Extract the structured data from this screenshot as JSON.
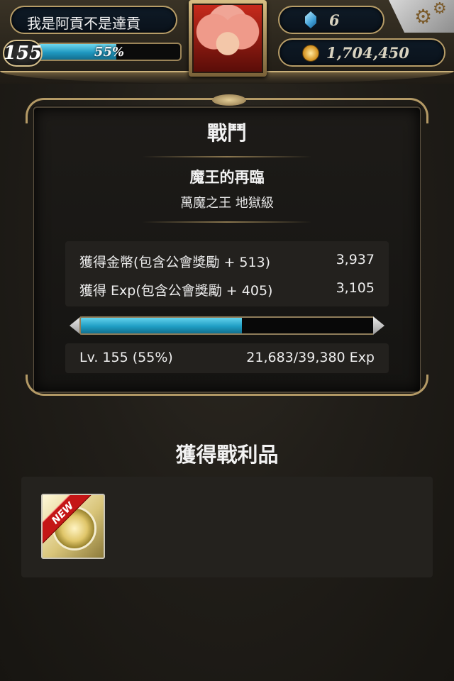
{
  "player": {
    "name": "我是阿貢不是達貢",
    "level": "155",
    "exp_percent_label": "55%",
    "exp_fraction": 0.55
  },
  "currency": {
    "gems": "6",
    "coins": "1,704,450"
  },
  "battle": {
    "title": "戰鬥",
    "stage_name": "魔王的再臨",
    "stage_sub": "萬魔之王 地獄級",
    "rewards": [
      {
        "label": "獲得金幣(包含公會獎勵 + 513)",
        "value": "3,937"
      },
      {
        "label": "獲得 Exp(包含公會獎勵 + 405)",
        "value": "3,105"
      }
    ],
    "exp_bar_fraction": 0.55,
    "level_label": "Lv. 155 (55%)",
    "exp_progress": "21,683/39,380 Exp"
  },
  "loot": {
    "title": "獲得戰利品",
    "items": [
      {
        "badge": "NEW",
        "icon": "gold-coin-card-icon"
      }
    ]
  },
  "colors": {
    "exp_bar": "#1f9ec4",
    "frame_gold": "#b49a66",
    "new_badge": "#c41616"
  }
}
